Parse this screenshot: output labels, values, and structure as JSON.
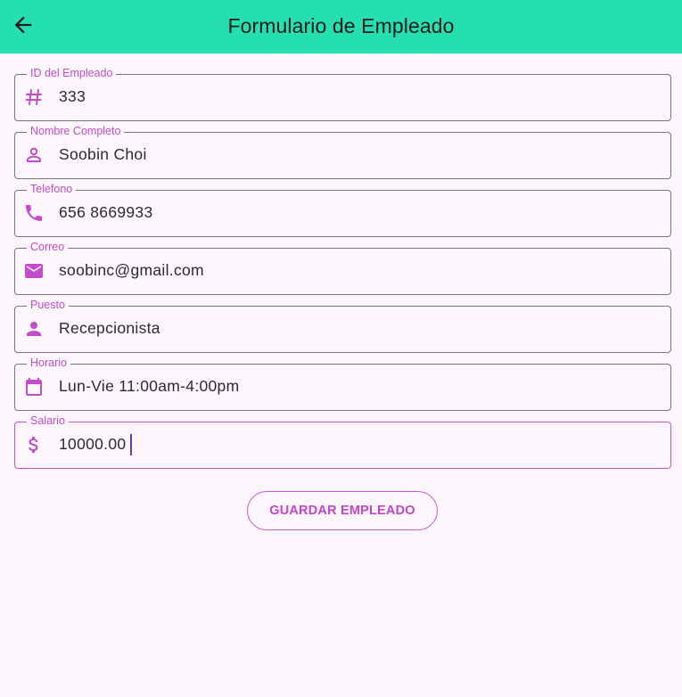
{
  "appbar": {
    "title": "Formulario de Empleado",
    "back_icon": "arrow-back-icon",
    "background_color": "#26dfb0"
  },
  "form": {
    "fields": [
      {
        "label": "ID del Empleado",
        "value": "333",
        "icon": "tag-icon"
      },
      {
        "label": "Nombre Completo",
        "value": "Soobin Choi",
        "icon": "person-outline-icon"
      },
      {
        "label": "Telefono",
        "value": "656 8669933",
        "icon": "phone-icon"
      },
      {
        "label": "Correo",
        "value": "soobinc@gmail.com",
        "icon": "email-icon"
      },
      {
        "label": "Puesto",
        "value": "Recepcionista",
        "icon": "person-icon"
      },
      {
        "label": "Horario",
        "value": "Lun-Vie 11:00am-4:00pm",
        "icon": "calendar-icon"
      },
      {
        "label": "Salario",
        "value": "10000.00",
        "icon": "dollar-icon"
      }
    ],
    "focused_field": "Salario",
    "accent_color": "#c44ccc"
  },
  "actions": {
    "save_label": "GUARDAR EMPLEADO"
  }
}
